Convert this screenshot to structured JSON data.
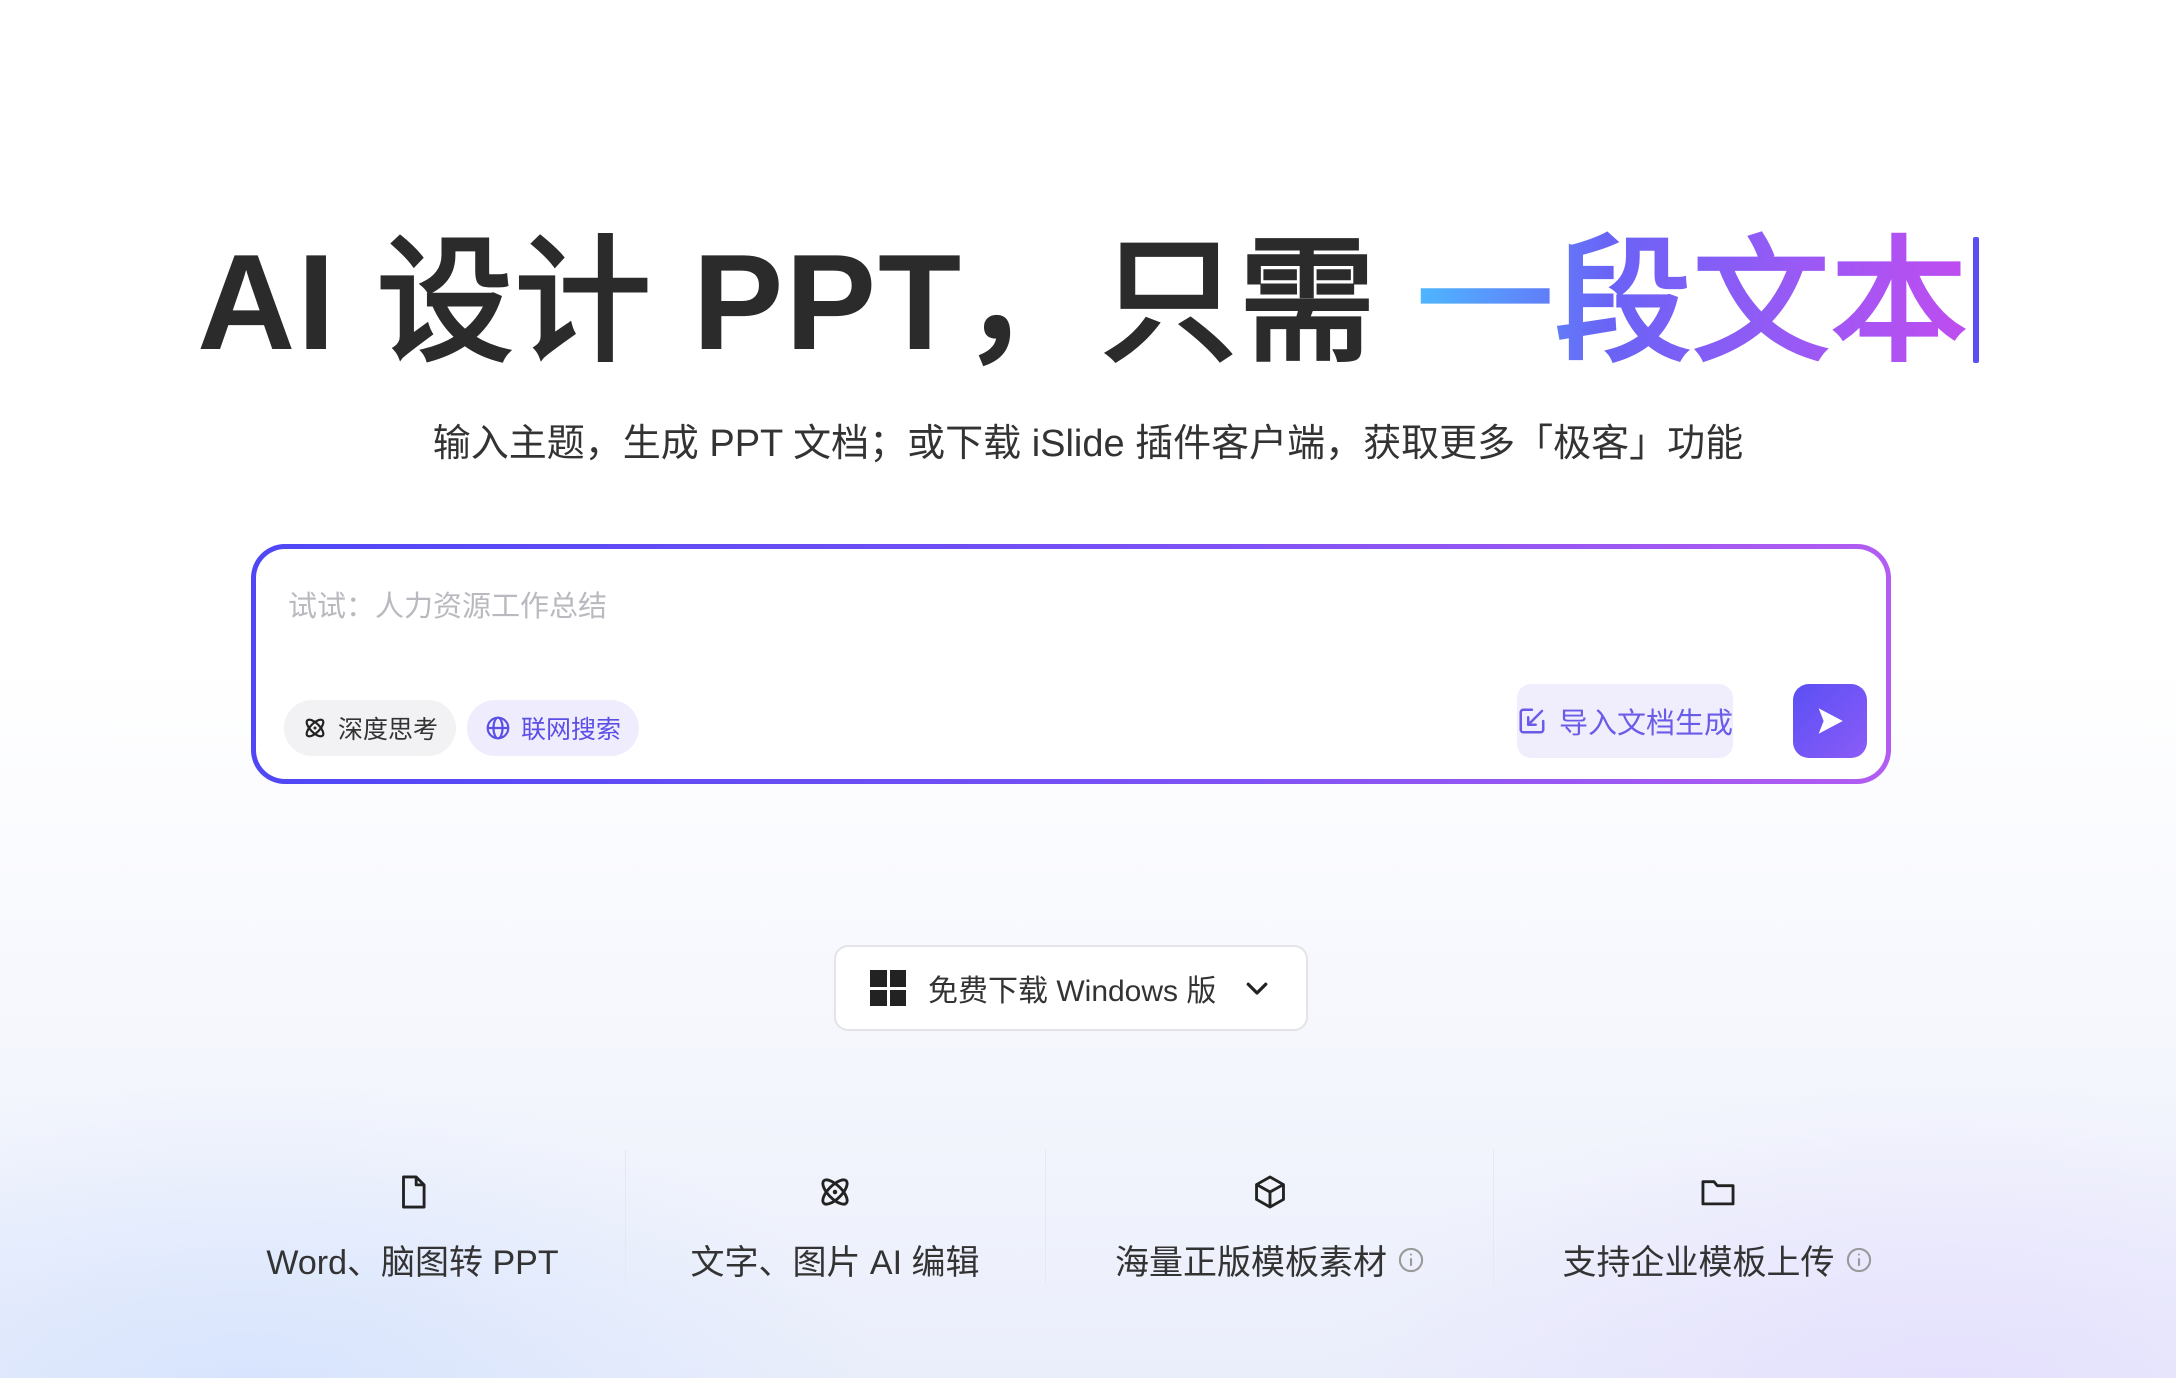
{
  "hero": {
    "title_plain": "AI 设计 PPT，只需 ",
    "title_highlight": "一段文本"
  },
  "subtitle": "输入主题，生成 PPT 文档；或下载 iSlide 插件客户端，获取更多「极客」功能",
  "prompt": {
    "value": "",
    "placeholder": "试试：人力资源工作总结",
    "deep_think_label": "深度思考",
    "web_search_label": "联网搜索",
    "import_label": "导入文档生成",
    "send_icon": "send-icon"
  },
  "download": {
    "label": "免费下载 Windows 版",
    "icon": "windows-icon"
  },
  "features": [
    {
      "label": "Word、脑图转 PPT",
      "icon": "file-icon"
    },
    {
      "label": "文字、图片 AI 编辑",
      "icon": "atom-icon"
    },
    {
      "label": "海量正版模板素材",
      "icon": "cube-icon"
    },
    {
      "label": "支持企业模板上传",
      "icon": "folder-icon"
    }
  ],
  "colors": {
    "accent": "#5b4fe6",
    "gradient_start": "#4db7ff",
    "gradient_end": "#c04cf0"
  }
}
